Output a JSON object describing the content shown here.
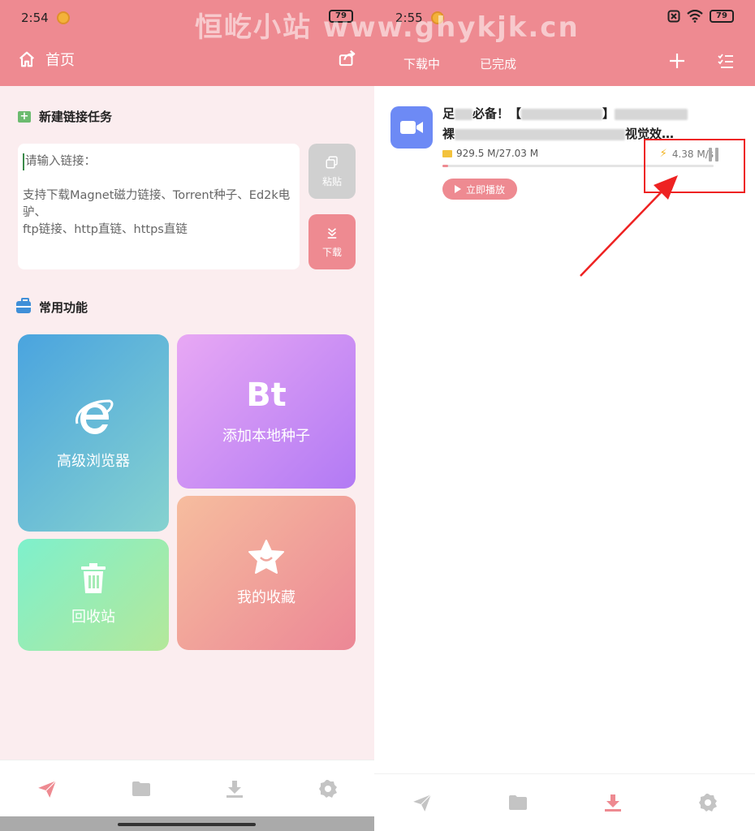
{
  "watermark": "恒屹小站 www.ghykjk.cn",
  "left": {
    "status": {
      "time": "2:54",
      "battery": "79"
    },
    "title": "首页",
    "new_task": {
      "title": "新建链接任务",
      "placeholder": "请输入链接：",
      "hint_line1": "支持下载Magnet磁力链接、Torrent种子、Ed2k电驴、",
      "hint_line2": "ftp链接、http直链、https直链",
      "paste_label": "粘贴",
      "download_label": "下载"
    },
    "common": {
      "title": "常用功能",
      "browser": "高级浏览器",
      "bt_logo": "Bt",
      "bt_label": "添加本地种子",
      "recycle": "回收站",
      "favorites": "我的收藏"
    }
  },
  "right": {
    "status": {
      "time": "2:55",
      "battery": "79"
    },
    "tabs": {
      "downloading": "下载中",
      "completed": "已完成"
    },
    "task": {
      "title_start": "足",
      "title_mid": "必备！【",
      "title_end": "】",
      "title_line2_start": "裸",
      "title_line2_end": "视觉效…",
      "size": "929.5 M/27.03 M",
      "speed": "4.38 M/s",
      "progress": 0.02,
      "play_label": "立即播放"
    }
  },
  "colors": {
    "brand": "#ee8a91",
    "highlight": "#e22222"
  }
}
